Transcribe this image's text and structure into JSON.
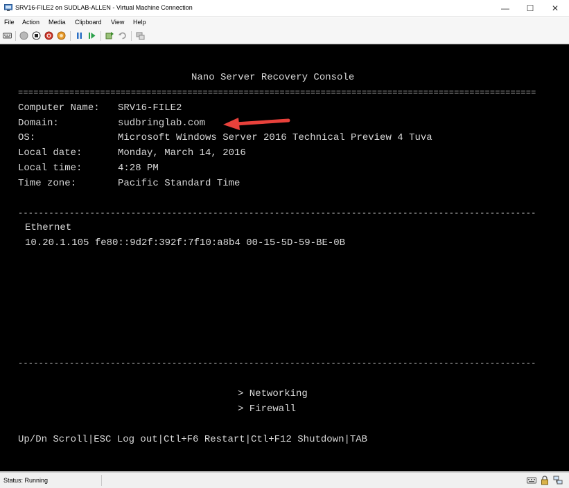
{
  "window": {
    "title": "SRV16-FILE2 on SUDLAB-ALLEN - Virtual Machine Connection",
    "min_glyph": "—",
    "max_glyph": "☐",
    "close_glyph": "✕"
  },
  "menu": {
    "items": [
      "File",
      "Action",
      "Media",
      "Clipboard",
      "View",
      "Help"
    ]
  },
  "toolbar": {
    "icons": [
      "ctrl-alt-del-icon",
      "start-icon",
      "turn-off-icon",
      "shutdown-icon",
      "save-icon",
      "pause-icon",
      "resume-icon",
      "checkpoint-icon",
      "revert-icon",
      "enhanced-session-icon"
    ]
  },
  "console": {
    "header": "Nano Server Recovery Console",
    "double_rule": "=====================================================================================================",
    "single_rule": "-----------------------------------------------------------------------------------------------------",
    "info": [
      {
        "label": "Computer Name:",
        "value": "SRV16-FILE2"
      },
      {
        "label": "Domain:",
        "value": "sudbringlab.com"
      },
      {
        "label": "OS:",
        "value": "Microsoft Windows Server 2016 Technical Preview 4 Tuva"
      },
      {
        "label": "Local date:",
        "value": "Monday, March 14, 2016"
      },
      {
        "label": "Local time:",
        "value": "4:28 PM"
      },
      {
        "label": "Time zone:",
        "value": "Pacific Standard Time"
      }
    ],
    "adapter_name": "Ethernet",
    "adapter_details": "10.20.1.105 fe80::9d2f:392f:7f10:a8b4 00-15-5D-59-BE-0B",
    "menu_items": [
      "> Networking",
      "> Firewall"
    ],
    "footer": "Up/Dn Scroll|ESC Log out|Ctl+F6 Restart|Ctl+F12 Shutdown|TAB"
  },
  "annotation": {
    "arrow_color": "#e8413b"
  },
  "status": {
    "text": "Status: Running",
    "icons": [
      "keyboard-icon",
      "lock-icon",
      "network-icon"
    ]
  }
}
